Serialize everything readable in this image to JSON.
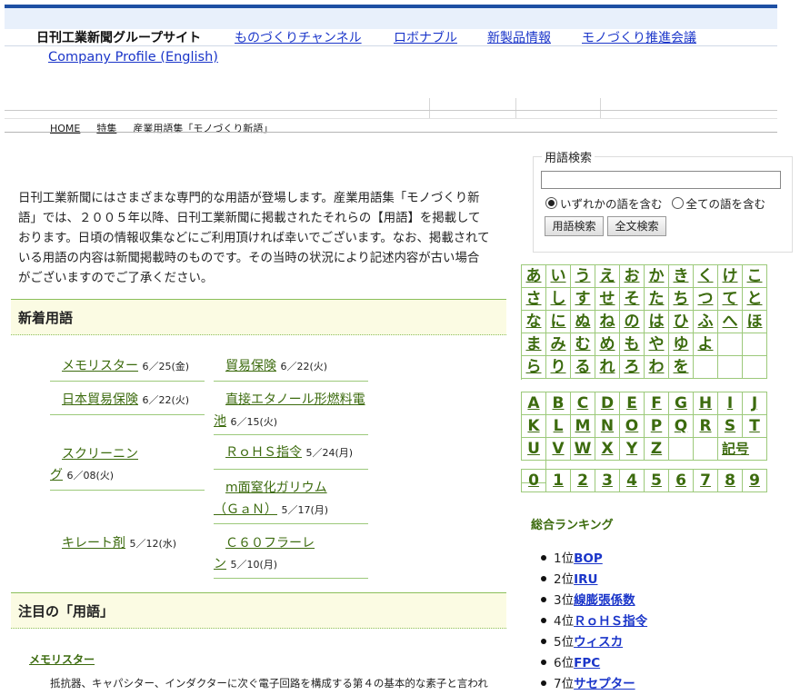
{
  "group_nav": {
    "brand": "日刊工業新聞グループサイト",
    "links": [
      "ものづくりチャンネル",
      "ロボナブル",
      "新製品情報",
      "モノづくり推進会議"
    ],
    "company_profile": "Company Profile (English)"
  },
  "breadcrumb": [
    "HOME",
    "特集",
    "産業用語集「モノづくり新語」"
  ],
  "intro": "日刊工業新聞にはさまざまな専門的な用語が登場します。産業用語集「モノづくり新語」では、２００５年以降、日刊工業新聞に掲載されたそれらの【用語】を掲載しております。日頃の情報収集などにご利用頂ければ幸いでございます。なお、掲載されている用語の内容は新聞掲載時のものです。その当時の状況により記述内容が古い場合がございますのでご了承ください。",
  "new_terms": {
    "heading": "新着用語",
    "items": [
      {
        "line1": "メモリスター",
        "line2": "",
        "date": "6／25(金)"
      },
      {
        "line1": "貿易保険",
        "line2": "",
        "date": "6／22(火)"
      },
      {
        "line1": "日本貿易保険",
        "line2": "",
        "date": "6／22(火)"
      },
      {
        "line1": "直接エタノール形燃料電",
        "line2": "池",
        "date": "6／15(火)"
      },
      {
        "line1": "スクリーニン",
        "line2": "グ",
        "date": "6／08(火)"
      },
      {
        "line1": "ＲｏＨＳ指令",
        "line2": "",
        "date": "5／24(月)"
      },
      {
        "line1": "m面窒化ガリウム",
        "line2": "（ＧａＮ）",
        "date": "5／17(月)"
      },
      {
        "line1": "キレート剤",
        "line2": "",
        "date": "5／12(水)"
      },
      {
        "line1": "Ｃ６０フラーレ",
        "line2": "ン",
        "date": "5／10(月)"
      }
    ]
  },
  "featured": {
    "heading": "注目の「用語」",
    "title": "メモリスター",
    "text": "抵抗器、キャパシター、インダクターに次ぐ電子回路を構成する第４の基本的な素子と言われ"
  },
  "search": {
    "legend": "用語検索",
    "input_value": "",
    "option_any": "いずれかの語を含む",
    "option_all": "全ての語を含む",
    "btn_term": "用語検索",
    "btn_full": "全文検索"
  },
  "kana_grid": [
    "あ",
    "い",
    "う",
    "え",
    "お",
    "か",
    "き",
    "く",
    "け",
    "こ",
    "さ",
    "し",
    "す",
    "せ",
    "そ",
    "た",
    "ち",
    "つ",
    "て",
    "と",
    "な",
    "に",
    "ぬ",
    "ね",
    "の",
    "は",
    "ひ",
    "ふ",
    "へ",
    "ほ",
    "ま",
    "み",
    "む",
    "め",
    "も",
    "や",
    "ゆ",
    "よ",
    "",
    "",
    "ら",
    "り",
    "る",
    "れ",
    "ろ",
    "わ",
    "を",
    "",
    "",
    ""
  ],
  "alpha_grid": [
    "A",
    "B",
    "C",
    "D",
    "E",
    "F",
    "G",
    "H",
    "I",
    "J",
    "K",
    "L",
    "M",
    "N",
    "O",
    "P",
    "Q",
    "R",
    "S",
    "T",
    "U",
    "V",
    "W",
    "X",
    "Y",
    "Z",
    "",
    "",
    "記号",
    ""
  ],
  "digit_grid": [
    "0",
    "1",
    "2",
    "3",
    "4",
    "5",
    "6",
    "7",
    "8",
    "9"
  ],
  "ranking": {
    "title": "総合ランキング",
    "items": [
      {
        "rank": "1位",
        "term": "BOP"
      },
      {
        "rank": "2位",
        "term": "IRU"
      },
      {
        "rank": "3位",
        "term": "線膨張係数"
      },
      {
        "rank": "4位",
        "term": "ＲｏＨＳ指令"
      },
      {
        "rank": "5位",
        "term": "ウィスカ"
      },
      {
        "rank": "6位",
        "term": "FPC"
      },
      {
        "rank": "7位",
        "term": "サセプター"
      }
    ]
  }
}
